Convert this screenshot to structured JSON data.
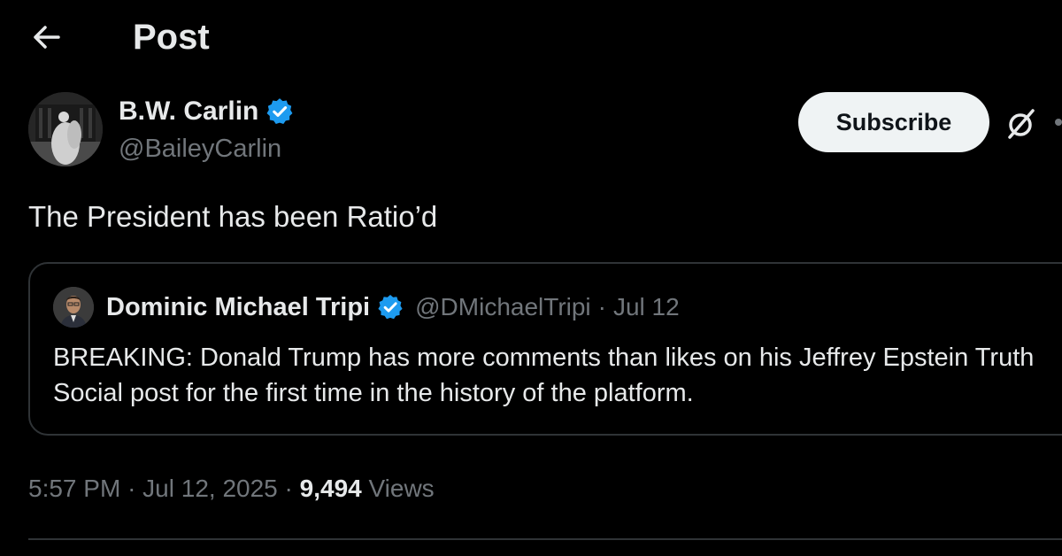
{
  "header": {
    "title": "Post",
    "back_icon": "arrow-left-icon"
  },
  "post": {
    "author": {
      "name": "B.W. Carlin",
      "handle": "@BaileyCarlin",
      "verified": true
    },
    "subscribe_label": "Subscribe",
    "text": "The President has been Ratio’d",
    "timestamp_time": "5:57 PM",
    "timestamp_date": "Jul 12, 2025",
    "separator": "·",
    "views_count": "9,494",
    "views_label": "Views"
  },
  "quote": {
    "author": {
      "name": "Dominic Michael Tripi",
      "handle": "@DMichaelTripi",
      "verified": true
    },
    "separator": "·",
    "date": "Jul 12",
    "text": "BREAKING: Donald Trump has more comments than likes on his Jeffrey Epstein Truth Social post for the first time in the history of the platform."
  },
  "colors": {
    "background": "#000000",
    "text_primary": "#e7e9ea",
    "text_secondary": "#71767b",
    "verified_blue": "#1d9bf0",
    "border": "#2f3336",
    "button_bg": "#eff3f4"
  }
}
